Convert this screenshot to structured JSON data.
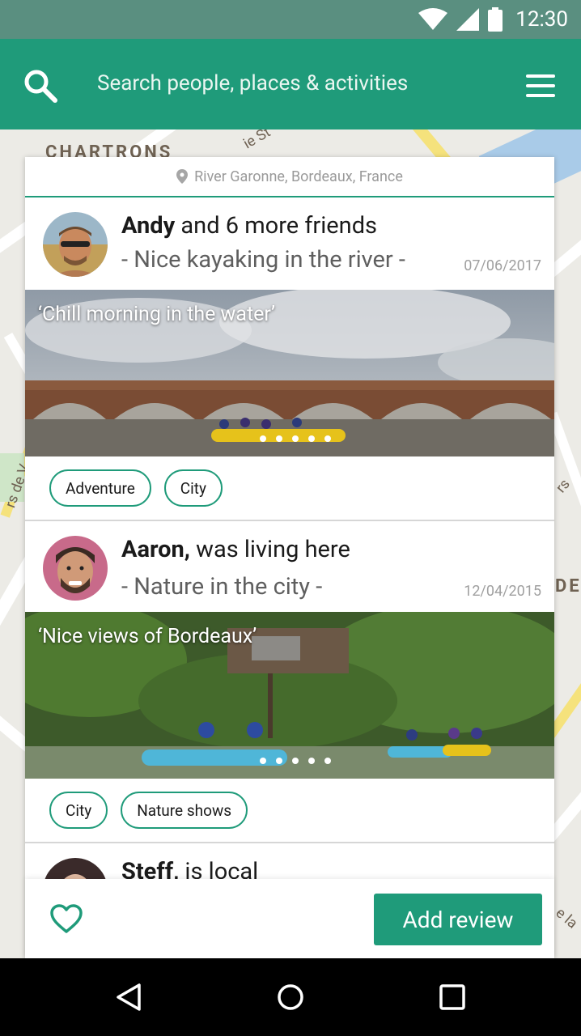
{
  "status_bar": {
    "time": "12:30"
  },
  "app_bar": {
    "search_placeholder": "Search people, places & activities"
  },
  "map": {
    "label_1": "CHARTRONS",
    "label_2": "DE",
    "label_3": "ie St",
    "label_4": "rs de V",
    "label_5": "rs",
    "label_6": "e la"
  },
  "card": {
    "location": "River Garonne, Bordeaux, France",
    "posts": [
      {
        "name": "Andy",
        "title_rest": " and 6 more friends",
        "subtitle": "- Nice kayaking in the river -",
        "date": "07/06/2017",
        "caption": "‘Chill morning in the water’",
        "tags": [
          "Adventure",
          "City"
        ]
      },
      {
        "name": "Aaron,",
        "title_rest": " was living here",
        "subtitle": "- Nature in the city -",
        "date": "12/04/2015",
        "caption": "‘Nice views of Bordeaux’",
        "tags": [
          "City",
          "Nature shows"
        ]
      },
      {
        "name": "Steff,",
        "title_rest": " is local"
      }
    ]
  },
  "action_bar": {
    "add_review_label": "Add review"
  },
  "colors": {
    "primary": "#1f9b7a",
    "status_bar": "#5a8f80"
  }
}
